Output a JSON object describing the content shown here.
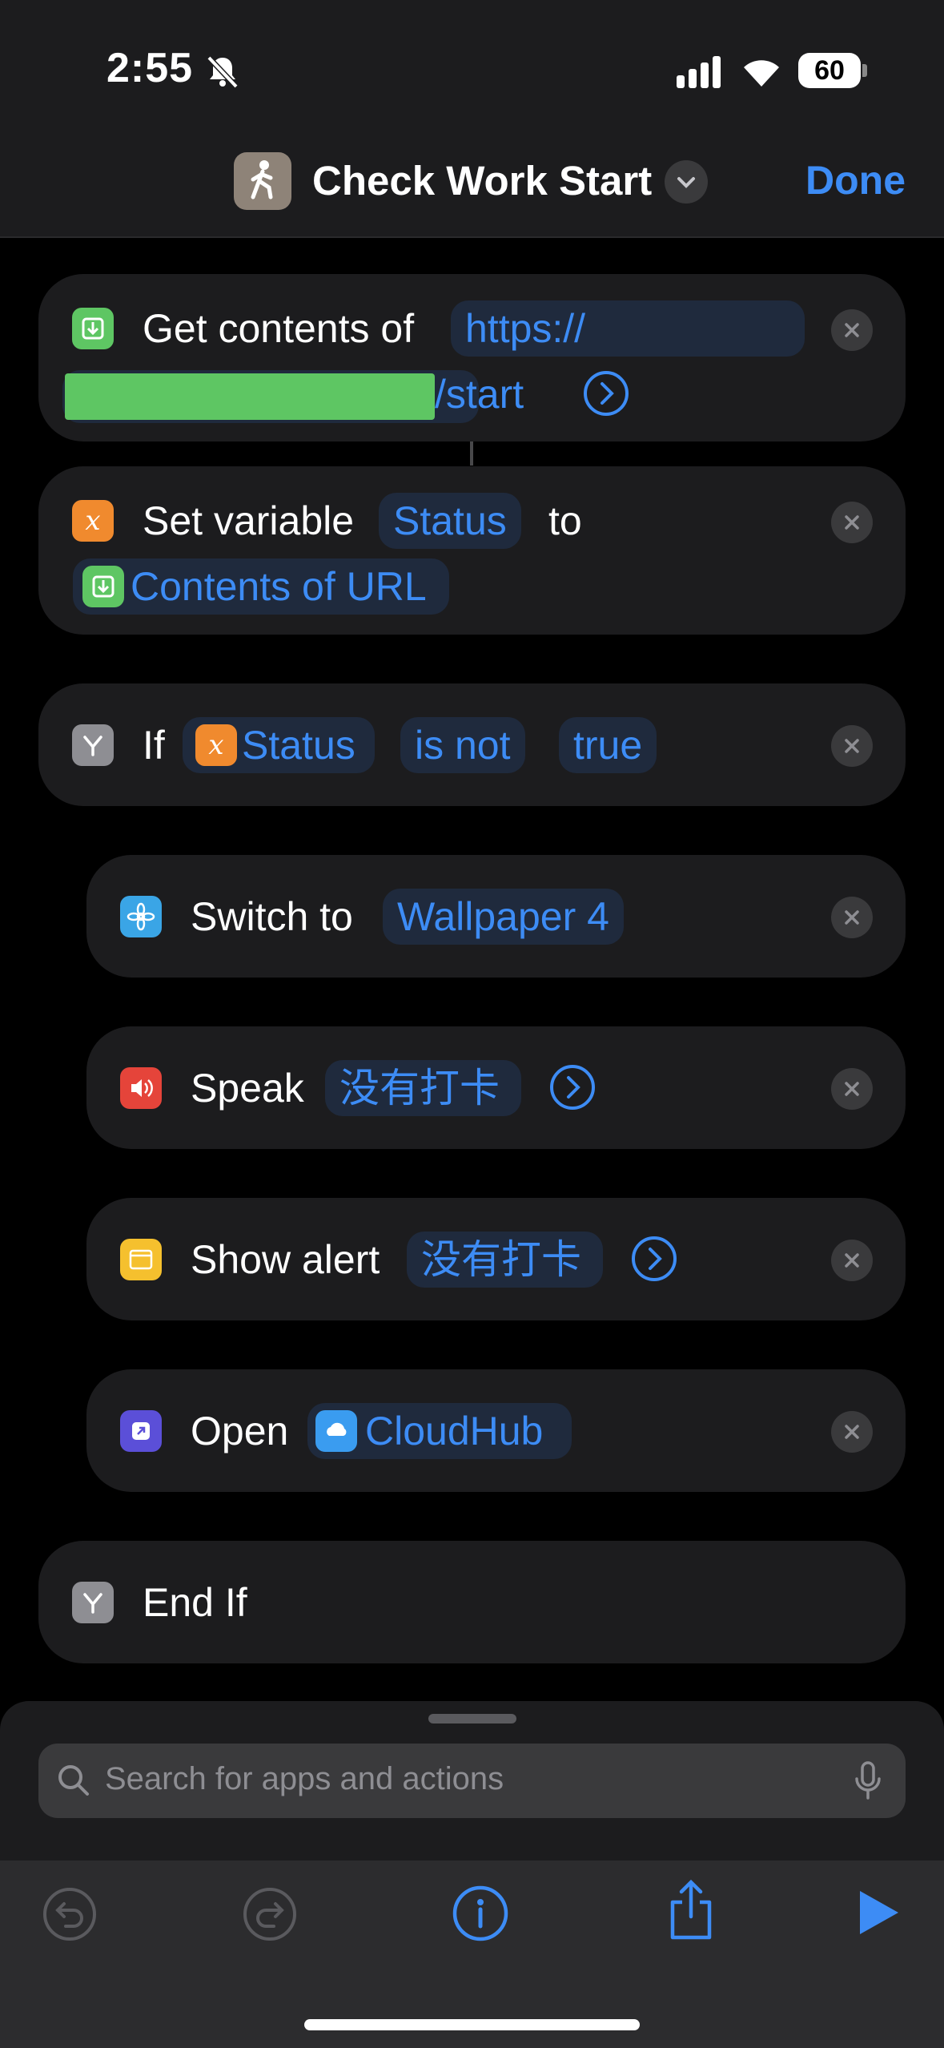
{
  "status_bar": {
    "time": "2:55",
    "battery": "60"
  },
  "nav": {
    "title": "Check Work Start",
    "done_label": "Done"
  },
  "actions": {
    "get_contents": {
      "label": "Get contents of",
      "url_start": "https://",
      "url_end": "/start"
    },
    "set_variable": {
      "label": "Set variable",
      "var": "Status",
      "to": "to",
      "value": "Contents of URL"
    },
    "if": {
      "label": "If",
      "var": "Status",
      "op": "is not",
      "value": "true"
    },
    "switch": {
      "label": "Switch to",
      "value": "Wallpaper 4"
    },
    "speak": {
      "label": "Speak",
      "value": "没有打卡"
    },
    "alert": {
      "label": "Show alert",
      "value": "没有打卡"
    },
    "open": {
      "label": "Open",
      "value": "CloudHub"
    },
    "end_if": {
      "label": "End If"
    }
  },
  "search": {
    "placeholder": "Search for apps and actions"
  },
  "colors": {
    "accent": "#3d8cf5",
    "redaction": "#5ec663"
  }
}
